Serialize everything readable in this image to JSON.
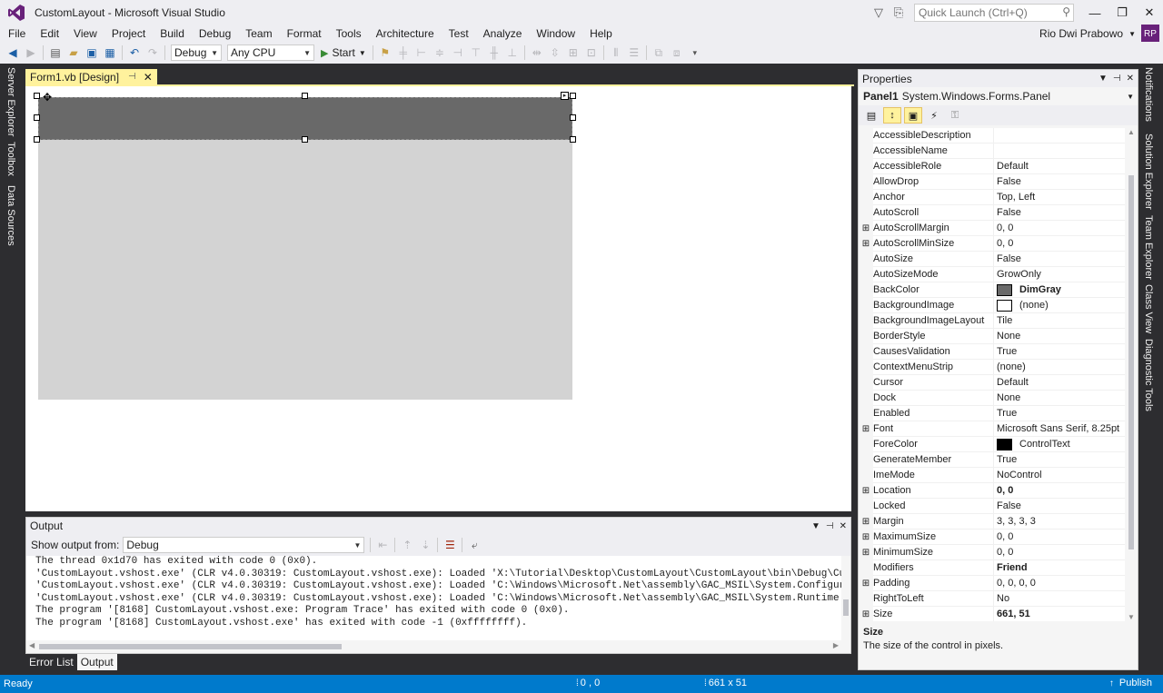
{
  "window": {
    "title": "CustomLayout - Microsoft Visual Studio",
    "quick_launch_placeholder": "Quick Launch (Ctrl+Q)",
    "user_name": "Rio Dwi Prabowo",
    "user_initials": "RP"
  },
  "menu": {
    "items": [
      "File",
      "Edit",
      "View",
      "Project",
      "Build",
      "Debug",
      "Team",
      "Format",
      "Tools",
      "Architecture",
      "Test",
      "Analyze",
      "Window",
      "Help"
    ]
  },
  "toolbar": {
    "configuration": "Debug",
    "platform": "Any CPU",
    "start_label": "Start"
  },
  "left_tabs": [
    "Server Explorer",
    "Toolbox",
    "Data Sources"
  ],
  "right_tabs": [
    "Notifications",
    "Solution Explorer",
    "Team Explorer",
    "Class View",
    "Diagnostic Tools"
  ],
  "document": {
    "tab_label": "Form1.vb [Design]"
  },
  "output": {
    "title": "Output",
    "show_from_label": "Show output from:",
    "source": "Debug",
    "lines": [
      "The thread 0x1d70 has exited with code 0 (0x0).",
      "'CustomLayout.vshost.exe' (CLR v4.0.30319: CustomLayout.vshost.exe): Loaded 'X:\\Tutorial\\Desktop\\CustomLayout\\CustomLayout\\bin\\Debug\\CustomLay",
      "'CustomLayout.vshost.exe' (CLR v4.0.30319: CustomLayout.vshost.exe): Loaded 'C:\\Windows\\Microsoft.Net\\assembly\\GAC_MSIL\\System.Configuration\\v",
      "'CustomLayout.vshost.exe' (CLR v4.0.30319: CustomLayout.vshost.exe): Loaded 'C:\\Windows\\Microsoft.Net\\assembly\\GAC_MSIL\\System.Runtime.Remotin",
      "The program '[8168] CustomLayout.vshost.exe: Program Trace' has exited with code 0 (0x0).",
      "The program '[8168] CustomLayout.vshost.exe' has exited with code -1 (0xffffffff)."
    ]
  },
  "bottom_tabs": [
    "Error List",
    "Output"
  ],
  "properties": {
    "title": "Properties",
    "object_name": "Panel1",
    "object_type": "System.Windows.Forms.Panel",
    "rows": [
      {
        "name": "AccessibleDescription",
        "value": "",
        "expand": false
      },
      {
        "name": "AccessibleName",
        "value": "",
        "expand": false
      },
      {
        "name": "AccessibleRole",
        "value": "Default",
        "expand": false
      },
      {
        "name": "AllowDrop",
        "value": "False",
        "expand": false
      },
      {
        "name": "Anchor",
        "value": "Top, Left",
        "expand": false
      },
      {
        "name": "AutoScroll",
        "value": "False",
        "expand": false
      },
      {
        "name": "AutoScrollMargin",
        "value": "0, 0",
        "expand": true
      },
      {
        "name": "AutoScrollMinSize",
        "value": "0, 0",
        "expand": true
      },
      {
        "name": "AutoSize",
        "value": "False",
        "expand": false
      },
      {
        "name": "AutoSizeMode",
        "value": "GrowOnly",
        "expand": false
      },
      {
        "name": "BackColor",
        "value": "DimGray",
        "expand": false,
        "swatch": "#696969",
        "bold": true
      },
      {
        "name": "BackgroundImage",
        "value": "(none)",
        "expand": false,
        "swatch": "#ffffff"
      },
      {
        "name": "BackgroundImageLayout",
        "value": "Tile",
        "expand": false
      },
      {
        "name": "BorderStyle",
        "value": "None",
        "expand": false
      },
      {
        "name": "CausesValidation",
        "value": "True",
        "expand": false
      },
      {
        "name": "ContextMenuStrip",
        "value": "(none)",
        "expand": false
      },
      {
        "name": "Cursor",
        "value": "Default",
        "expand": false
      },
      {
        "name": "Dock",
        "value": "None",
        "expand": false
      },
      {
        "name": "Enabled",
        "value": "True",
        "expand": false
      },
      {
        "name": "Font",
        "value": "Microsoft Sans Serif, 8.25pt",
        "expand": true
      },
      {
        "name": "ForeColor",
        "value": "ControlText",
        "expand": false,
        "swatch": "#000000"
      },
      {
        "name": "GenerateMember",
        "value": "True",
        "expand": false
      },
      {
        "name": "ImeMode",
        "value": "NoControl",
        "expand": false
      },
      {
        "name": "Location",
        "value": "0, 0",
        "expand": true,
        "bold": true
      },
      {
        "name": "Locked",
        "value": "False",
        "expand": false
      },
      {
        "name": "Margin",
        "value": "3, 3, 3, 3",
        "expand": true
      },
      {
        "name": "MaximumSize",
        "value": "0, 0",
        "expand": true
      },
      {
        "name": "MinimumSize",
        "value": "0, 0",
        "expand": true
      },
      {
        "name": "Modifiers",
        "value": "Friend",
        "expand": false,
        "bold": true
      },
      {
        "name": "Padding",
        "value": "0, 0, 0, 0",
        "expand": true
      },
      {
        "name": "RightToLeft",
        "value": "No",
        "expand": false
      },
      {
        "name": "Size",
        "value": "661, 51",
        "expand": true,
        "bold": true
      }
    ],
    "description_title": "Size",
    "description_text": "The size of the control in pixels."
  },
  "status": {
    "text": "Ready",
    "position": "0 , 0",
    "size": "661 x 51",
    "publish": "Publish"
  },
  "colors": {
    "accent": "#007acc",
    "panel_backcolor": "#696969",
    "form_backcolor": "#d3d3d3",
    "active_tab": "#fff29d"
  }
}
